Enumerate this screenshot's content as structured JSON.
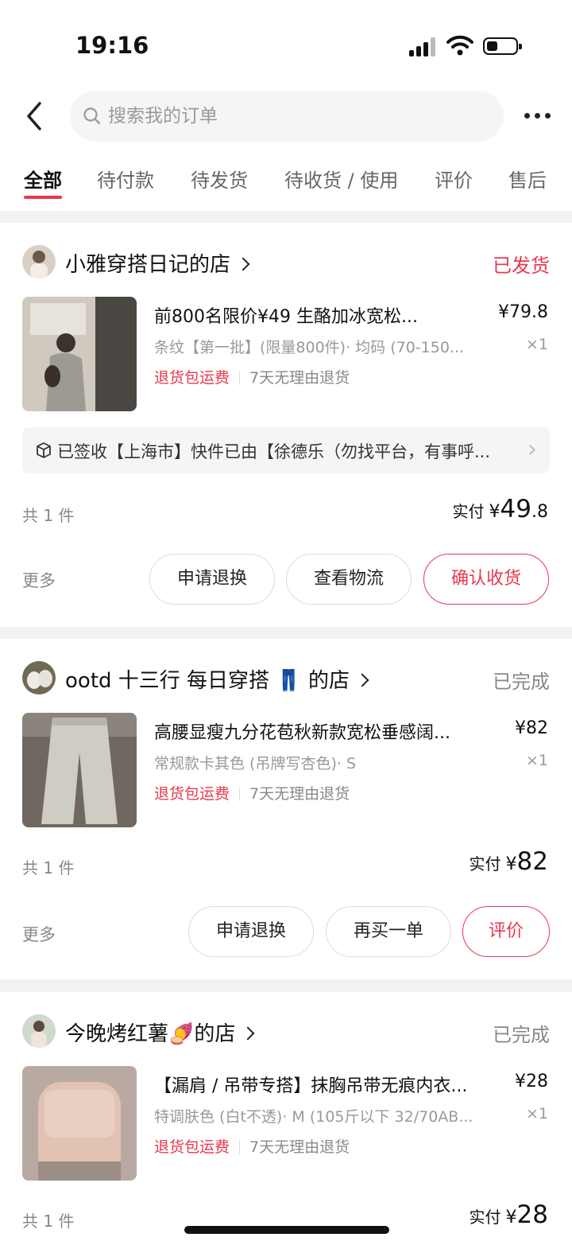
{
  "status_bar": {
    "time": "19:16"
  },
  "search": {
    "placeholder": "搜索我的订单"
  },
  "tabs": [
    "全部",
    "待付款",
    "待发货",
    "待收货 / 使用",
    "评价",
    "售后"
  ],
  "orders": [
    {
      "shop": "小雅穿搭日记的店",
      "status": "已发货",
      "product": "前800名限价¥49 生酪加冰宽松...",
      "price": "¥79.8",
      "spec": "条纹【第一批】(限量800件)· 均码 (70-150...",
      "qty": "×1",
      "tag_return": "退货包运费",
      "tag_policy": "7天无理由退货",
      "logistics": "已签收【上海市】快件已由【徐德乐（勿找平台，有事呼...",
      "count": "共 1 件",
      "paid_label": "实付",
      "paid_currency": "¥",
      "paid_int": "49",
      "paid_dec": ".8",
      "more": "更多",
      "buttons": [
        "申请退换",
        "查看物流",
        "确认收货"
      ]
    },
    {
      "shop": "ootd 十三行 每日穿搭 👖 的店",
      "status": "已完成",
      "product": "高腰显瘦九分花苞秋新款宽松垂感阔...",
      "price": "¥82",
      "spec": "常规款卡其色 (吊牌写杏色)· S",
      "qty": "×1",
      "tag_return": "退货包运费",
      "tag_policy": "7天无理由退货",
      "count": "共 1 件",
      "paid_label": "实付",
      "paid_currency": "¥",
      "paid_int": "82",
      "more": "更多",
      "buttons": [
        "申请退换",
        "再买一单",
        "评价"
      ]
    },
    {
      "shop": "今晚烤红薯🍠的店",
      "status": "已完成",
      "product": "【漏肩 / 吊带专搭】抹胸吊带无痕内衣...",
      "price": "¥28",
      "spec": "特调肤色 (白t不透)· M (105斤以下 32/70AB...",
      "qty": "×1",
      "tag_return": "退货包运费",
      "tag_policy": "7天无理由退货",
      "count": "共 1 件",
      "paid_label": "实付",
      "paid_currency": "¥",
      "paid_int": "28"
    }
  ],
  "colors": {
    "accent": "#e8384f",
    "muted": "#888888",
    "background": "#f2f2f2"
  },
  "icons": [
    "back-arrow-icon",
    "search-icon",
    "more-icon",
    "package-icon",
    "chevron-right-icon",
    "signal-icon",
    "wifi-icon",
    "battery-icon"
  ]
}
